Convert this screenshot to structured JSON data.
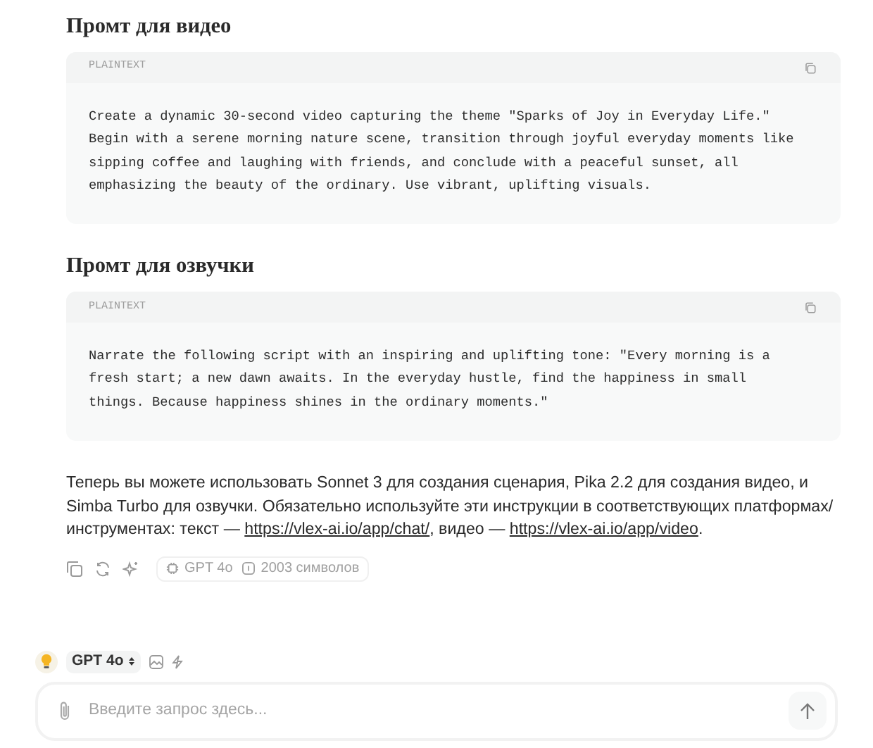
{
  "sections": [
    {
      "heading": "Промт для видео",
      "code": {
        "language": "PLAINTEXT",
        "text": "Create a dynamic 30-second video capturing the theme \"Sparks of Joy in Everyday Life.\" Begin with a serene morning nature scene, transition through joyful everyday moments like sipping coffee and laughing with friends, and conclude with a peaceful sunset, all emphasizing the beauty of the ordinary. Use vibrant, uplifting visuals."
      }
    },
    {
      "heading": "Промт для озвучки",
      "code": {
        "language": "PLAINTEXT",
        "text": "Narrate the following script with an inspiring and uplifting tone: \"Every morning is a fresh start; a new dawn awaits. In the everyday hustle, find the happiness in small things. Because happiness shines in the ordinary moments.\""
      }
    }
  ],
  "paragraph": [
    {
      "kind": "text",
      "text": "Теперь вы можете использовать Sonnet 3 для создания сценария, Pika 2.2 для создания видео, и Simba Turbo для озвучки. Обязательно используйте эти инструкции в соответствующих платформах/ инструментах: текст — "
    },
    {
      "kind": "link",
      "text": "https://vlex-ai.io/app/chat/"
    },
    {
      "kind": "text",
      "text": ", видео — "
    },
    {
      "kind": "link",
      "text": "https://vlex-ai.io/app/video"
    },
    {
      "kind": "text",
      "text": "."
    }
  ],
  "message_meta": {
    "model": "GPT 4o",
    "characters": "2003 символов"
  },
  "composer": {
    "model": "GPT 4o",
    "placeholder": "Введите запрос здесь..."
  }
}
